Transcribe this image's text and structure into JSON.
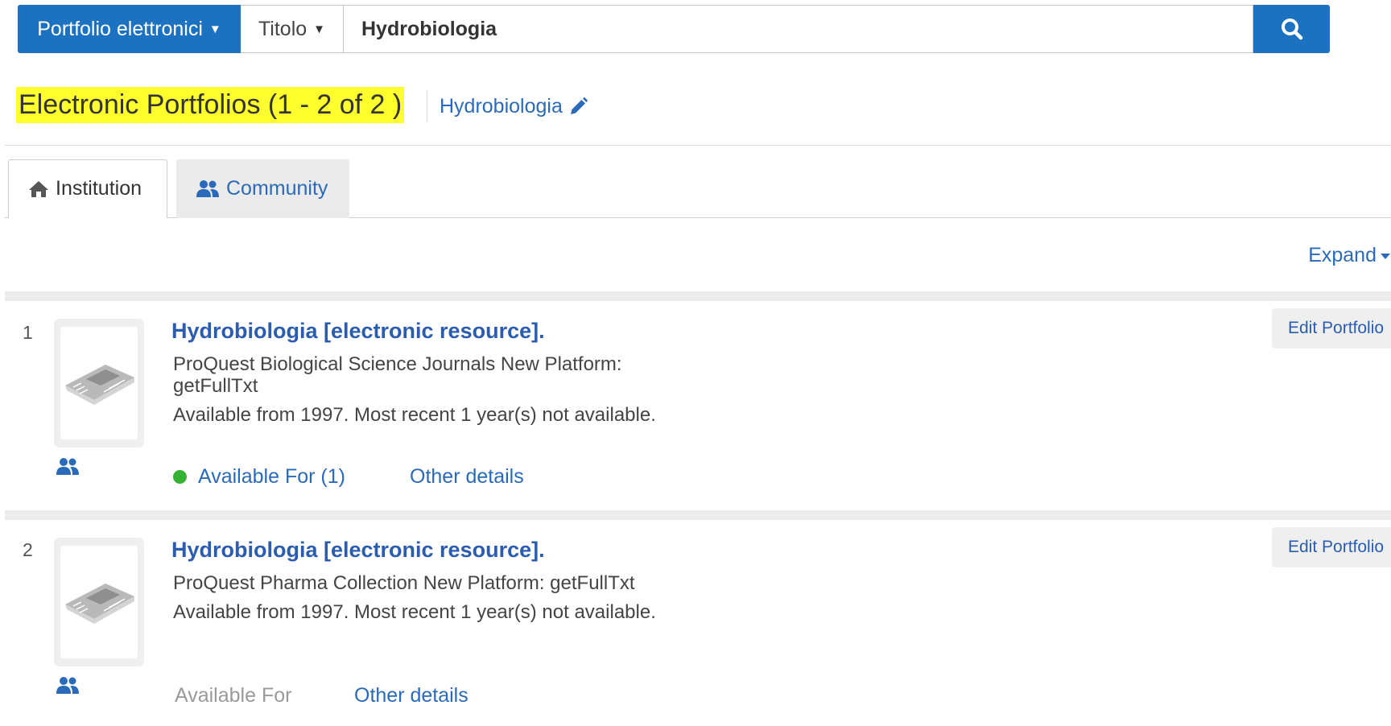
{
  "search": {
    "scope_label": "Portfolio elettronici",
    "field_label": "Titolo",
    "query": "Hydrobiologia",
    "caret": "▼",
    "icon": "search-icon"
  },
  "header": {
    "results_title": "Electronic Portfolios (1 - 2 of 2 )",
    "query_link": "Hydrobiologia",
    "query_link_icon": "pencil-icon",
    "highlight_color": "#ffff2e"
  },
  "tabs": [
    {
      "label": "Institution",
      "icon": "home-icon",
      "active": true
    },
    {
      "label": "Community",
      "icon": "users-icon",
      "active": false
    }
  ],
  "expand_label": "Expand",
  "results": [
    {
      "number": "1",
      "title": "Hydrobiologia [electronic resource].",
      "lines": [
        "ProQuest Biological Science Journals New Platform:",
        "getFullTxt",
        "Available from 1997. Most recent 1 year(s) not available."
      ],
      "available_label": "Available For (1)",
      "available_status": "active",
      "status_color": "#34b233",
      "other_details": "Other details",
      "edit_label": "Edit Portfolio"
    },
    {
      "number": "2",
      "title": "Hydrobiologia [electronic resource].",
      "lines": [
        "ProQuest Pharma Collection New Platform: getFullTxt",
        "Available from 1997. Most recent 1 year(s) not available."
      ],
      "available_label": "Available For",
      "available_status": "inactive",
      "other_details": "Other details",
      "edit_label": "Edit Portfolio"
    }
  ],
  "colors": {
    "primary": "#1c72c1",
    "link": "#2a6ab8",
    "title_link": "#2a5db0"
  }
}
